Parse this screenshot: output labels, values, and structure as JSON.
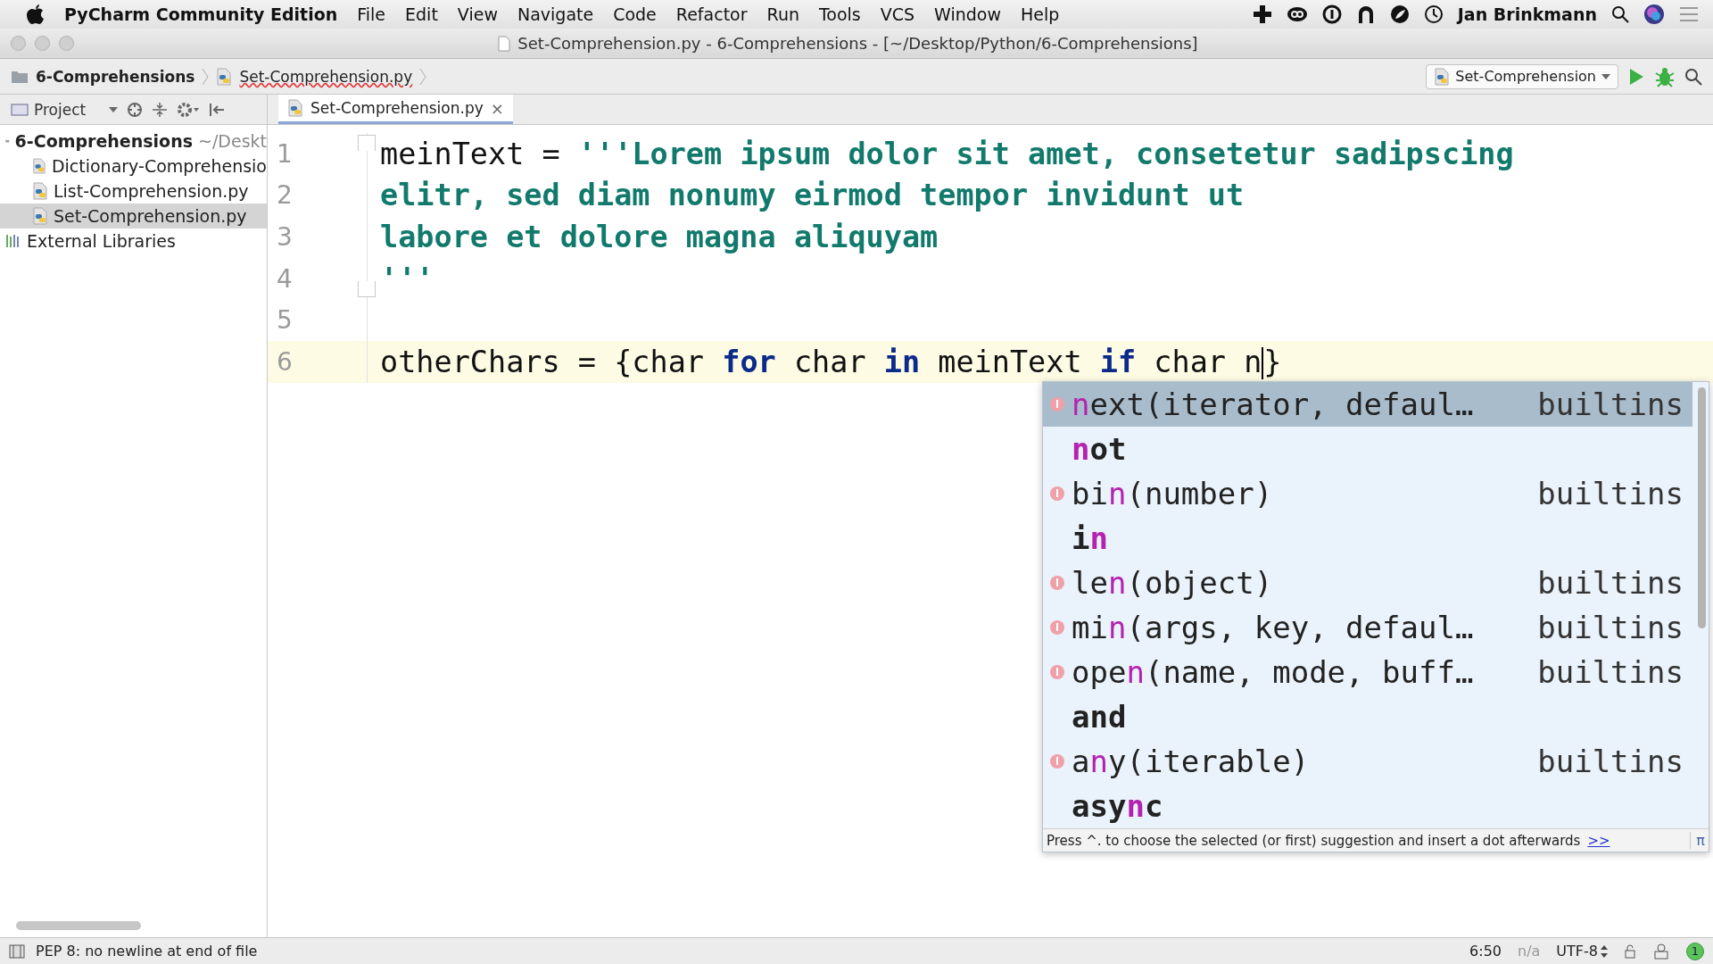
{
  "menu_bar": {
    "app": "PyCharm Community Edition",
    "items": [
      "File",
      "Edit",
      "View",
      "Navigate",
      "Code",
      "Refactor",
      "Run",
      "Tools",
      "VCS",
      "Window",
      "Help"
    ],
    "user": "Jan Brinkmann"
  },
  "window": {
    "title": "Set-Comprehension.py - 6-Comprehensions - [~/Desktop/Python/6-Comprehensions]"
  },
  "breadcrumbs": [
    {
      "label": "6-Comprehensions",
      "kind": "folder"
    },
    {
      "label": "Set-Comprehension.py",
      "kind": "file"
    }
  ],
  "run_config": "Set-Comprehension",
  "project_panel": {
    "label": "Project",
    "tree": [
      {
        "label": "6-Comprehensions",
        "path": "~/Deskt",
        "kind": "folder",
        "selected": false,
        "children": [
          {
            "label": "Dictionary-Comprehensio",
            "kind": "file",
            "selected": false
          },
          {
            "label": "List-Comprehension.py",
            "kind": "file",
            "selected": false
          },
          {
            "label": "Set-Comprehension.py",
            "kind": "file",
            "selected": true
          }
        ]
      },
      {
        "label": "External Libraries",
        "kind": "library",
        "selected": false
      }
    ]
  },
  "tabs": [
    {
      "label": "Set-Comprehension.py",
      "selected": true,
      "close": "×"
    }
  ],
  "editor": {
    "lines": [
      {
        "number": "1",
        "current": false,
        "fold_start": true,
        "segments": [
          {
            "kind": "plain",
            "text": "meinText = "
          },
          {
            "kind": "string",
            "text": "'''Lorem ipsum dolor sit amet, consetetur sadipscing"
          }
        ]
      },
      {
        "number": "2",
        "current": false,
        "segments": [
          {
            "kind": "string",
            "text": "elitr, sed diam nonumy eirmod tempor invidunt ut"
          }
        ]
      },
      {
        "number": "3",
        "current": false,
        "segments": [
          {
            "kind": "string",
            "text": "labore et dolore magna aliquyam"
          }
        ]
      },
      {
        "number": "4",
        "current": false,
        "fold_end": true,
        "segments": [
          {
            "kind": "string",
            "text": "'''"
          }
        ]
      },
      {
        "number": "5",
        "current": false
      },
      {
        "number": "6",
        "current": true,
        "segments": [
          {
            "kind": "plain",
            "text": "otherChars = {char "
          },
          {
            "kind": "keyword",
            "text": "for"
          },
          {
            "kind": "plain",
            "text": " char "
          },
          {
            "kind": "keyword",
            "text": "in"
          },
          {
            "kind": "plain",
            "text": " meinText "
          },
          {
            "kind": "keyword",
            "text": "if"
          },
          {
            "kind": "plain",
            "text": " char n"
          },
          {
            "kind": "caret"
          },
          {
            "kind": "plain",
            "text": "}"
          }
        ]
      }
    ]
  },
  "completion": {
    "items": [
      {
        "kind": "function",
        "match": "n",
        "post": "ext(iterator, defaul…",
        "source": "builtins",
        "selected": true
      },
      {
        "kind": "keyword",
        "match": "n",
        "post": "ot",
        "selected": false
      },
      {
        "kind": "function",
        "pre": "bi",
        "match": "n",
        "post": "(number)",
        "source": "builtins",
        "selected": false
      },
      {
        "kind": "keyword",
        "pre": "i",
        "match": "n",
        "selected": false
      },
      {
        "kind": "function",
        "pre": "le",
        "match": "n",
        "post": "(object)",
        "source": "builtins",
        "selected": false
      },
      {
        "kind": "function",
        "pre": "mi",
        "match": "n",
        "post": "(args, key, defaul…",
        "source": "builtins",
        "selected": false
      },
      {
        "kind": "function",
        "pre": "ope",
        "match": "n",
        "post": "(name, mode, buff…",
        "source": "builtins",
        "selected": false
      },
      {
        "kind": "keyword",
        "pre": "and",
        "selected": false
      },
      {
        "kind": "function",
        "pre": "a",
        "match": "n",
        "post": "y(iterable)",
        "source": "builtins",
        "selected": false
      },
      {
        "kind": "keyword",
        "pre": "asy",
        "match": "n",
        "post": "c",
        "selected": false
      }
    ],
    "hint": "Press ^. to choose the selected (or first) suggestion and insert a dot afterwards",
    "hint_link": ">>",
    "pi": "π"
  },
  "status_bar": {
    "message": "PEP 8: no newline at end of file",
    "position": "6:50",
    "vcs": "n/a",
    "encoding": "UTF-8",
    "badge": "1"
  }
}
